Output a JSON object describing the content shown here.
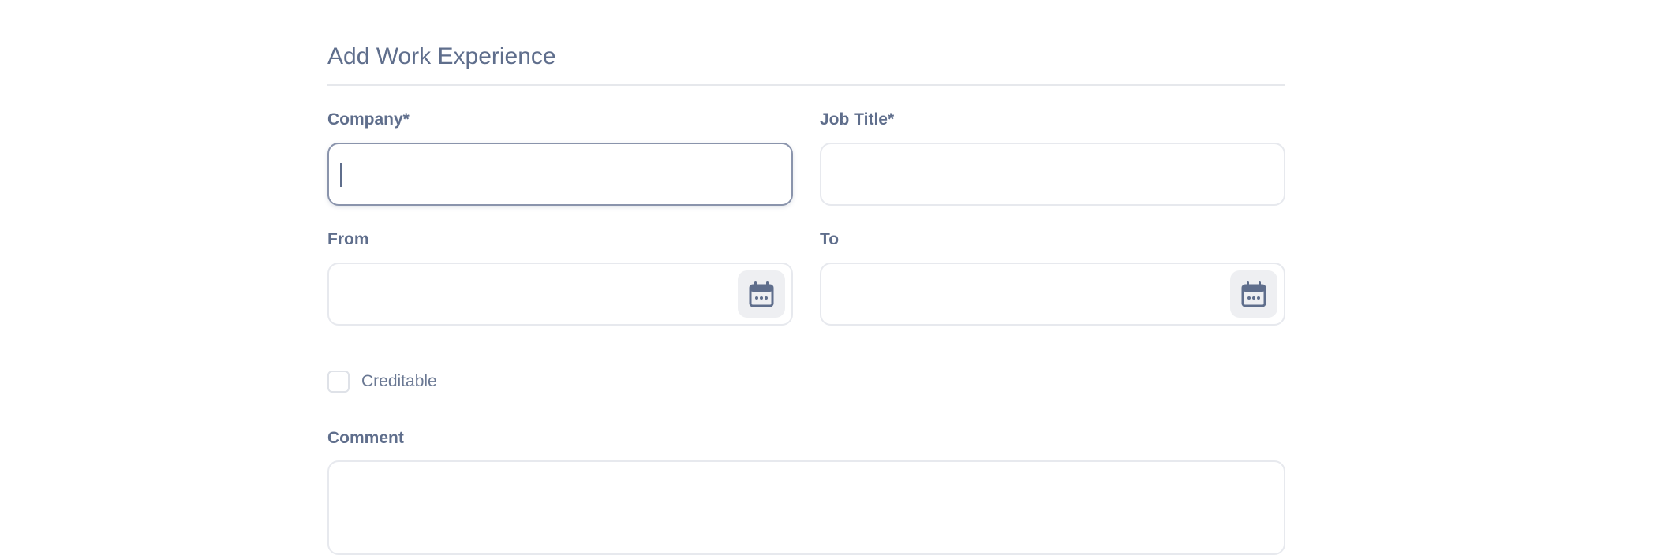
{
  "form": {
    "title": "Add Work Experience",
    "company": {
      "label": "Company*",
      "value": ""
    },
    "job_title": {
      "label": "Job Title*",
      "value": ""
    },
    "from": {
      "label": "From",
      "value": "",
      "icon": "calendar-icon"
    },
    "to": {
      "label": "To",
      "value": "",
      "icon": "calendar-icon"
    },
    "creditable": {
      "label": "Creditable",
      "checked": false
    },
    "comment": {
      "label": "Comment",
      "value": ""
    }
  },
  "colors": {
    "text": "#5f6e8c",
    "border": "#e7e9ee",
    "focus_border": "#8a94ac",
    "icon_bg": "#eeeff2"
  }
}
